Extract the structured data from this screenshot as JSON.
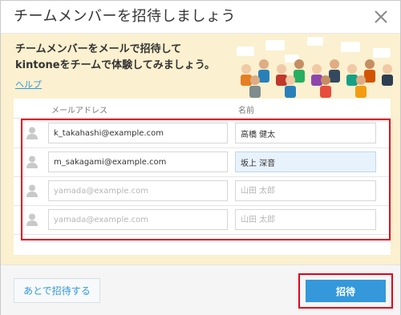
{
  "dialog": {
    "title": "チームメンバーを招待しましょう"
  },
  "intro": {
    "line1": "チームメンバーをメールで招待して",
    "line2": "kintoneをチームで体験してみましょう。",
    "help_link": "ヘルプ"
  },
  "table": {
    "header_email": "メールアドレス",
    "header_name": "名前",
    "rows": [
      {
        "email": "k_takahashi@example.com",
        "name": "高橋 健太",
        "email_placeholder": "",
        "name_placeholder": ""
      },
      {
        "email": "m_sakagami@example.com",
        "name": "坂上 深音",
        "email_placeholder": "",
        "name_placeholder": ""
      },
      {
        "email": "",
        "name": "",
        "email_placeholder": "yamada@example.com",
        "name_placeholder": "山田 太郎"
      },
      {
        "email": "",
        "name": "",
        "email_placeholder": "yamada@example.com",
        "name_placeholder": "山田 太郎"
      }
    ]
  },
  "footer": {
    "later_label": "あとで招待する",
    "invite_label": "招待"
  },
  "colors": {
    "accent": "#3498db",
    "highlight_border": "#e3001b",
    "promo_background": "#fbf0cf"
  },
  "icons": {
    "close": "close-icon",
    "avatar": "user-avatar-icon",
    "illustration": "people-crowd-illustration"
  }
}
